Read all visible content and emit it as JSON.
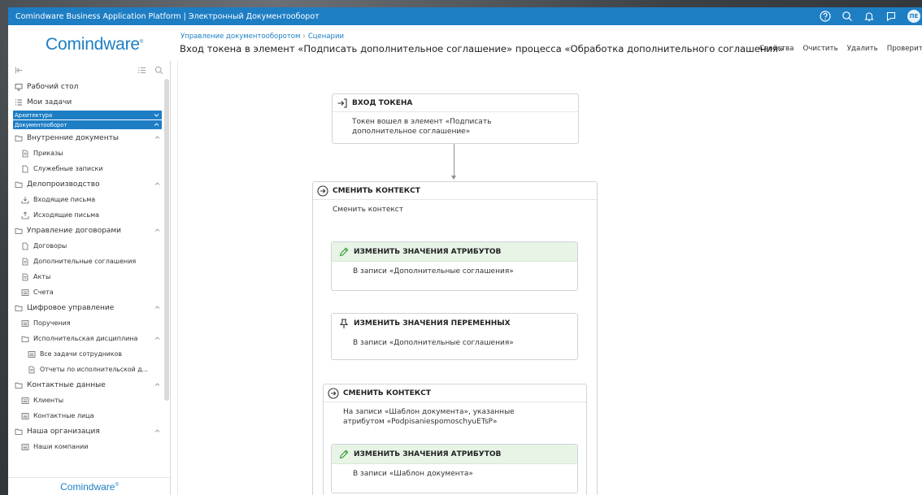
{
  "topbar": {
    "title": "Comindware Business Application Platform | Электронный Документооборот",
    "avatar": "ПЕ",
    "icons": [
      "help-icon",
      "search-icon",
      "bell-icon",
      "flag-icon"
    ]
  },
  "header": {
    "logo": "Comindware",
    "breadcrumb": [
      "Управление документооборотом",
      "Сценарии"
    ],
    "title": "Вход токена в элемент «Подписать дополнительное соглашение» процесса «Обработка дополнительного соглашения»",
    "actions": [
      "Свойства",
      "Очистить",
      "Удалить",
      "Проверить"
    ]
  },
  "sidebar": {
    "top_items": [
      {
        "label": "Рабочий стол",
        "icon": "desktop-icon"
      },
      {
        "label": "Мои задачи",
        "icon": "tasks-icon"
      }
    ],
    "sections": [
      "Архитектура",
      "Документооборот"
    ],
    "tree": [
      {
        "label": "Внутренние документы",
        "level": 0,
        "icon": "folder-icon",
        "expanded": true
      },
      {
        "label": "Приказы",
        "level": 1,
        "icon": "document-icon"
      },
      {
        "label": "Служебные записки",
        "level": 1,
        "icon": "page-icon"
      },
      {
        "label": "Делопроизводство",
        "level": 0,
        "icon": "folder-icon",
        "expanded": true
      },
      {
        "label": "Входящие письма",
        "level": 1,
        "icon": "inbox-icon"
      },
      {
        "label": "Исходящие письма",
        "level": 1,
        "icon": "outbox-icon"
      },
      {
        "label": "Управление договорами",
        "level": 0,
        "icon": "folder-icon",
        "expanded": true
      },
      {
        "label": "Договоры",
        "level": 1,
        "icon": "page-icon"
      },
      {
        "label": "Дополнительные соглашения",
        "level": 1,
        "icon": "document-icon"
      },
      {
        "label": "Акты",
        "level": 1,
        "icon": "document-icon"
      },
      {
        "label": "Счета",
        "level": 1,
        "icon": "table-icon"
      },
      {
        "label": "Цифровое управление",
        "level": 0,
        "icon": "folder-icon",
        "expanded": true
      },
      {
        "label": "Поручения",
        "level": 1,
        "icon": "table-icon"
      },
      {
        "label": "Исполнительская дисциплина",
        "level": 1,
        "icon": "folder-icon",
        "expanded": true
      },
      {
        "label": "Все задачи сотрудников",
        "level": 2,
        "icon": "table-icon"
      },
      {
        "label": "Отчеты по исполнительской д...",
        "level": 2,
        "icon": "document-icon"
      },
      {
        "label": "Контактные данные",
        "level": 0,
        "icon": "folder-icon",
        "expanded": true
      },
      {
        "label": "Клиенты",
        "level": 1,
        "icon": "table-icon"
      },
      {
        "label": "Контактные лица",
        "level": 1,
        "icon": "table-icon"
      },
      {
        "label": "Наша организация",
        "level": 0,
        "icon": "folder-icon",
        "expanded": true
      },
      {
        "label": "Наши компании",
        "level": 1,
        "icon": "table-icon"
      }
    ],
    "footer_logo": "Comindware"
  },
  "diagram": {
    "token": {
      "title": "ВХОД ТОКЕНА",
      "text": "Токен вошел в элемент «Подписать дополнительное соглашение»"
    },
    "context1": {
      "title": "СМЕНИТЬ КОНТЕКСТ",
      "text": "Сменить контекст"
    },
    "attrs1": {
      "title": "ИЗМЕНИТЬ ЗНАЧЕНИЯ АТРИБУТОВ",
      "text": "В записи «Дополнительные соглашения»"
    },
    "vars": {
      "title": "ИЗМЕНИТЬ ЗНАЧЕНИЯ ПЕРЕМЕННЫХ",
      "text": "В записи «Дополнительные соглашения»"
    },
    "context2": {
      "title": "СМЕНИТЬ КОНТЕКСТ",
      "text": "На записи «Шаблон документа», указанные атрибутом «PodpisaniespomoschyuETsP»"
    },
    "attrs2": {
      "title": "ИЗМЕНИТЬ ЗНАЧЕНИЯ АТРИБУТОВ",
      "text": "В записи «Шаблон документа»"
    }
  },
  "colors": {
    "brand": "#1d7ec4",
    "green_header": "#e7f4e6"
  }
}
